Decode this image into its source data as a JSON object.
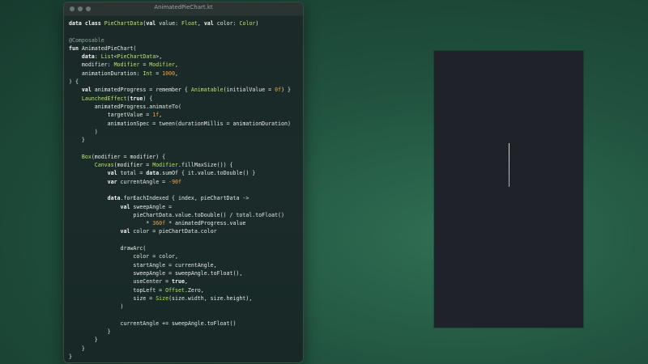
{
  "window": {
    "title": "AnimatedPieChart.kt"
  },
  "code_lines": [
    "data class PieChartData(val value: Float, val color: Color)",
    "",
    "@Composable",
    "fun AnimatedPieChart(",
    "    data: List<PieChartData>,",
    "    modifier: Modifier = Modifier,",
    "    animationDuration: Int = 1000,",
    ") {",
    "    val animatedProgress = remember { Animatable(initialValue = 0f) }",
    "    LaunchedEffect(true) {",
    "        animatedProgress.animateTo(",
    "            targetValue = 1f,",
    "            animationSpec = tween(durationMillis = animationDuration)",
    "        )",
    "    }",
    "",
    "    Box(modifier = modifier) {",
    "        Canvas(modifier = Modifier.fillMaxSize()) {",
    "            val total = data.sumOf { it.value.toDouble() }",
    "            var currentAngle = -90f",
    "",
    "            data.forEachIndexed { index, pieChartData ->",
    "                val sweepAngle =",
    "                    pieChartData.value.toDouble() / total.toFloat()",
    "                        * 360f * animatedProgress.value",
    "                val color = pieChartData.color",
    "",
    "                drawArc(",
    "                    color = color,",
    "                    startAngle = currentAngle,",
    "                    sweepAngle = sweepAngle.toFloat(),",
    "                    useCenter = true,",
    "                    topLeft = Offset.Zero,",
    "                    size = Size(size.width, size.height),",
    "                )",
    "",
    "                currentAngle += sweepAngle.toFloat()",
    "            }",
    "        }",
    "    }",
    "}"
  ],
  "theme": {
    "keyword_color": "#f2f4f3",
    "type_color": "#b8e26a",
    "annotation_color": "#8ea29c",
    "number_color": "#f0a24a",
    "param_color": "#c7e06a",
    "text_color": "#e6eae8"
  },
  "preview": {}
}
